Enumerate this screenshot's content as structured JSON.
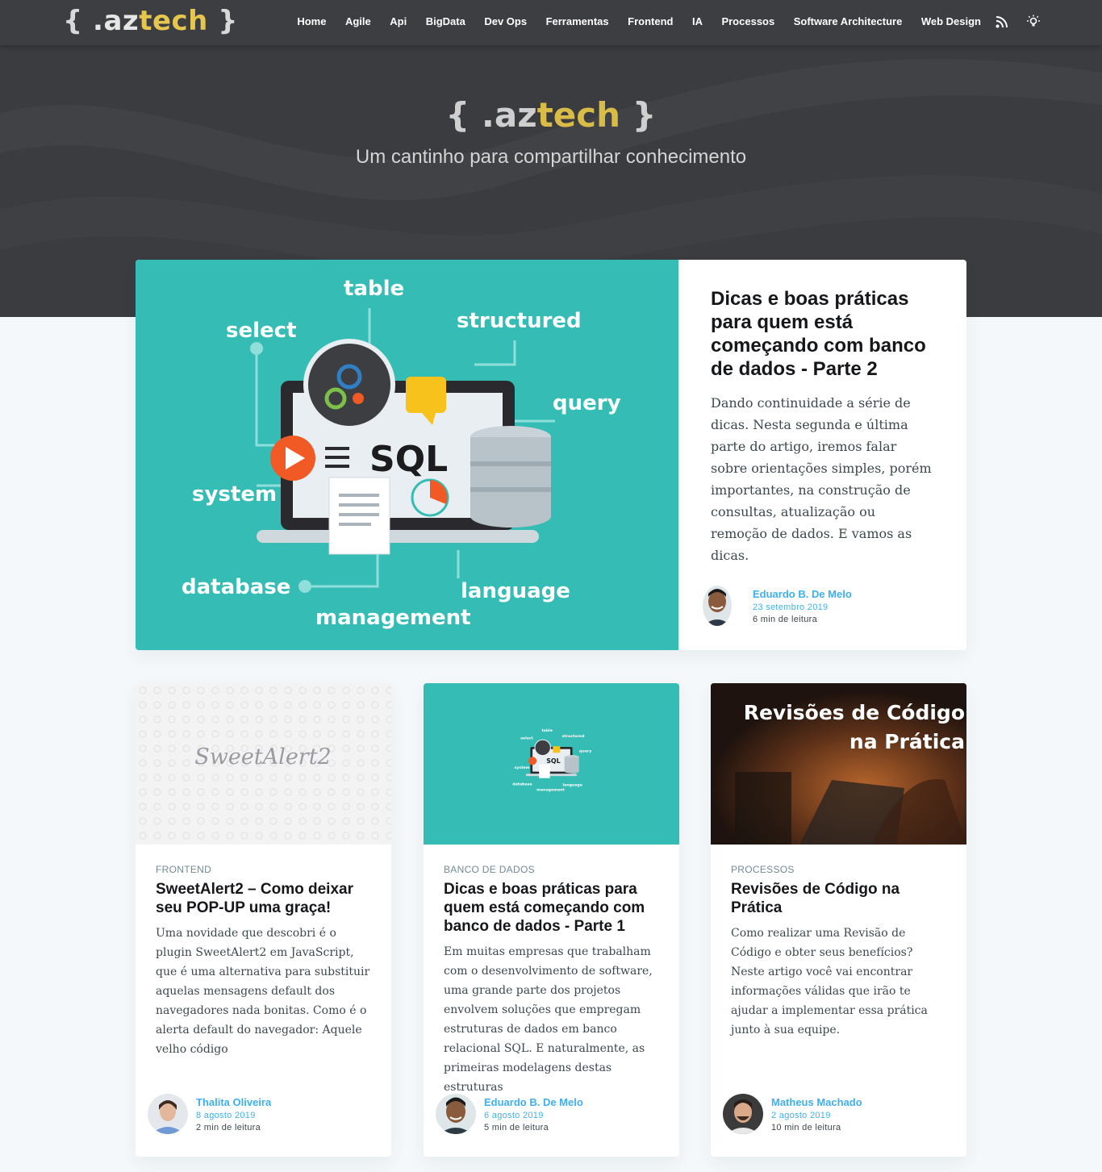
{
  "site": {
    "logo_open": "{",
    "logo_dot_az": " .az",
    "logo_tech": "tech",
    "logo_close": " }",
    "tagline": "Um cantinho para compartilhar conhecimento"
  },
  "nav": {
    "items": [
      {
        "label": "Home"
      },
      {
        "label": "Agile"
      },
      {
        "label": "Api"
      },
      {
        "label": "BigData"
      },
      {
        "label": "Dev Ops"
      },
      {
        "label": "Ferramentas"
      },
      {
        "label": "Frontend"
      },
      {
        "label": "IA"
      },
      {
        "label": "Processos"
      },
      {
        "label": "Software Architecture"
      },
      {
        "label": "Web Design"
      }
    ],
    "icons": [
      "rss-icon",
      "lightbulb-icon"
    ]
  },
  "featured": {
    "image_words": [
      "table",
      "select",
      "structured",
      "query",
      "system",
      "database",
      "management",
      "language",
      "SQL"
    ],
    "title": "Dicas e boas práticas para quem está começando com banco de dados - Parte 2",
    "excerpt": "Dando continuidade a série de dicas. Nesta segunda e última parte do artigo, iremos falar sobre orientações simples, porém importantes, na construção de consultas, atualização ou remoção de dados. E vamos as dicas.",
    "author": "Eduardo B. De Melo",
    "date": "23 setembro 2019",
    "reading_time": "6 min de leitura"
  },
  "cards": [
    {
      "image_text": "SweetAlert2",
      "tag": "FRONTEND",
      "title": "SweetAlert2 – Como deixar seu POP-UP uma graça!",
      "excerpt": "Uma novidade que descobri é o plugin SweetAlert2 em JavaScript, que é uma alternativa para substituir aquelas mensagens default dos navegadores nada bonitas. Como é o alerta default do navegador: Aquele velho código",
      "author": "Thalita Oliveira",
      "date": "8 agosto 2019",
      "reading_time": "2 min de leitura"
    },
    {
      "tag": "BANCO DE DADOS",
      "title": "Dicas e boas práticas para quem está começando com banco de dados - Parte 1",
      "excerpt": "Em muitas empresas que trabalham com o desenvolvimento de software, uma grande parte dos projetos envolvem soluções que empregam estruturas de dados em banco relacional SQL. E naturalmente, as primeiras modelagens destas estruturas",
      "author": "Eduardo B. De Melo",
      "date": "6 agosto 2019",
      "reading_time": "5 min de leitura"
    },
    {
      "image_text_line1": "Revisões de Código",
      "image_text_line2": "na Prática",
      "tag": "PROCESSOS",
      "title": "Revisões de Código na Prática",
      "excerpt": "Como realizar uma Revisão de Código e obter seus benefícios? Neste artigo você vai encontrar informações válidas que irão te ajudar a implementar essa prática junto à sua equipe.",
      "author": "Matheus Machado",
      "date": "2 agosto 2019",
      "reading_time": "10 min de leitura"
    }
  ],
  "colors": {
    "header_bg": "#3b3c40",
    "accent": "#3eb0ef",
    "logo_yellow": "#e5c64e",
    "sql_teal": "#35bdb5"
  }
}
